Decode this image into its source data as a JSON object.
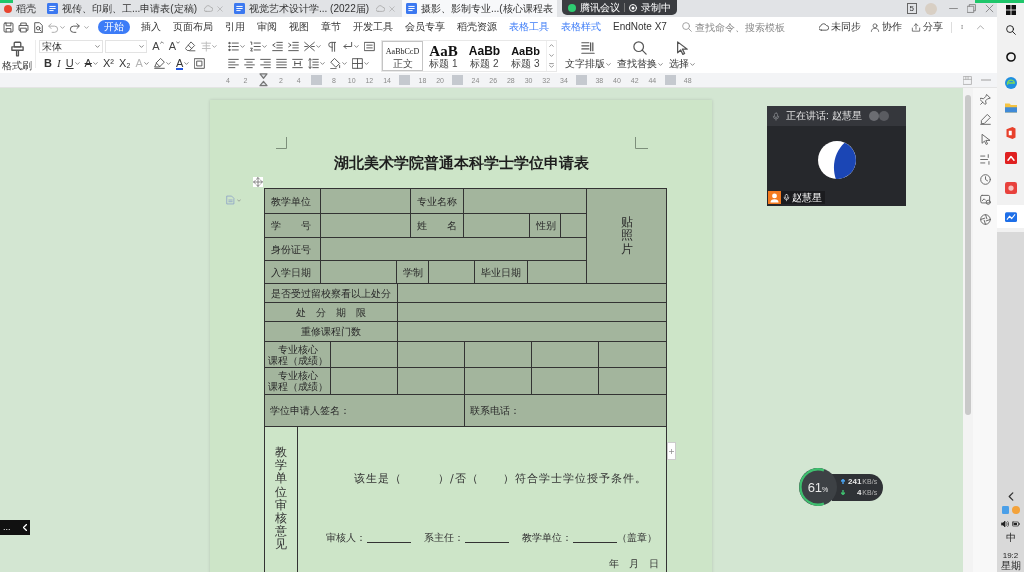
{
  "window_tabs": {
    "tabs": [
      {
        "kind": "home",
        "label": "稻壳",
        "selected": false
      },
      {
        "kind": "document",
        "label": "视传、印刷、工...申请表(定稿)",
        "selected": false
      },
      {
        "kind": "document",
        "label": "视觉艺术设计学... (2022届)",
        "selected": false
      },
      {
        "kind": "document",
        "label": "摄影、影制专业...(核心课程表",
        "selected": true
      }
    ],
    "window_count": "5"
  },
  "meeting_bar": {
    "app": "腾讯会议",
    "recording": "录制中"
  },
  "ribbon": {
    "tabs": [
      {
        "label": "开始",
        "selected": true,
        "contextual": false
      },
      {
        "label": "插入",
        "selected": false,
        "contextual": false
      },
      {
        "label": "页面布局",
        "selected": false,
        "contextual": false
      },
      {
        "label": "引用",
        "selected": false,
        "contextual": false
      },
      {
        "label": "审阅",
        "selected": false,
        "contextual": false
      },
      {
        "label": "视图",
        "selected": false,
        "contextual": false
      },
      {
        "label": "章节",
        "selected": false,
        "contextual": false
      },
      {
        "label": "开发工具",
        "selected": false,
        "contextual": false
      },
      {
        "label": "会员专享",
        "selected": false,
        "contextual": false
      },
      {
        "label": "稻壳资源",
        "selected": false,
        "contextual": false
      },
      {
        "label": "表格工具",
        "selected": false,
        "contextual": true
      },
      {
        "label": "表格样式",
        "selected": false,
        "contextual": true
      },
      {
        "label": "EndNote X7",
        "selected": false,
        "contextual": false
      }
    ],
    "search": {
      "placeholder": "查找命令、搜索模板"
    },
    "actions": [
      {
        "kind": "sync",
        "label": "未同步"
      },
      {
        "kind": "collaborate",
        "label": "协作"
      },
      {
        "kind": "share",
        "label": "分享"
      }
    ]
  },
  "toolbar": {
    "format_painter": "格式刷",
    "font": {
      "value": "宋体"
    },
    "font_tools": [
      {
        "kind": "grow",
        "glyph": "A"
      },
      {
        "kind": "shrink",
        "glyph": "A"
      },
      {
        "kind": "clear"
      },
      {
        "kind": "phonetic"
      }
    ],
    "format_tools": [
      {
        "kind": "bold",
        "glyph": "B"
      },
      {
        "kind": "italic",
        "glyph": "I"
      },
      {
        "kind": "underline",
        "glyph": "U"
      },
      {
        "kind": "strike",
        "glyph": "A"
      },
      {
        "kind": "superscript",
        "glyph": "X²"
      },
      {
        "kind": "subscript",
        "glyph": "X₂"
      },
      {
        "kind": "effect",
        "glyph": "A"
      },
      {
        "kind": "highlight"
      },
      {
        "kind": "color",
        "glyph": "A"
      },
      {
        "kind": "border"
      }
    ],
    "styles": [
      {
        "kind": "body",
        "preview": "AaBbCcD",
        "label": "正文",
        "selected": true
      },
      {
        "kind": "heading1",
        "preview": "AaB",
        "label": "标题 1",
        "selected": false
      },
      {
        "kind": "heading2",
        "preview": "AaBb",
        "label": "标题 2",
        "selected": false
      },
      {
        "kind": "heading3",
        "preview": "AaBb",
        "label": "标题 3",
        "selected": false
      }
    ],
    "tools": [
      {
        "kind": "layout",
        "label": "文字排版"
      },
      {
        "kind": "find",
        "label": "查找替换"
      },
      {
        "kind": "select",
        "label": "选择"
      }
    ]
  },
  "ruler": {
    "ticks": [
      {
        "kind": "number",
        "label": "4"
      },
      {
        "kind": "number",
        "label": "2"
      },
      {
        "kind": "indent"
      },
      {
        "kind": "number",
        "label": "2"
      },
      {
        "kind": "number",
        "label": "4"
      },
      {
        "kind": "marker"
      },
      {
        "kind": "number",
        "label": "8"
      },
      {
        "kind": "number",
        "label": "10"
      },
      {
        "kind": "number",
        "label": "12"
      },
      {
        "kind": "number",
        "label": "14"
      },
      {
        "kind": "marker"
      },
      {
        "kind": "number",
        "label": "18"
      },
      {
        "kind": "number",
        "label": "20"
      },
      {
        "kind": "marker"
      },
      {
        "kind": "number",
        "label": "24"
      },
      {
        "kind": "number",
        "label": "26"
      },
      {
        "kind": "number",
        "label": "28"
      },
      {
        "kind": "number",
        "label": "30"
      },
      {
        "kind": "number",
        "label": "32"
      },
      {
        "kind": "number",
        "label": "34"
      },
      {
        "kind": "marker"
      },
      {
        "kind": "number",
        "label": "38"
      },
      {
        "kind": "number",
        "label": "40"
      },
      {
        "kind": "number",
        "label": "42"
      },
      {
        "kind": "number",
        "label": "44"
      },
      {
        "kind": "marker"
      },
      {
        "kind": "number",
        "label": "48"
      }
    ]
  },
  "document": {
    "title": "湖北美术学院普通本科学士学位申请表",
    "table": {
      "upper_rows": [
        {
          "cells": [
            {
              "kind": "label",
              "text": "教学单位"
            },
            {
              "kind": "blank"
            },
            {
              "kind": "label",
              "text": "专业名称"
            },
            {
              "kind": "blank"
            }
          ]
        },
        {
          "cells": [
            {
              "kind": "label",
              "text": "学　　号"
            },
            {
              "kind": "blank"
            },
            {
              "kind": "label",
              "text": "姓　　名"
            },
            {
              "kind": "blank"
            },
            {
              "kind": "label",
              "text": "性别"
            },
            {
              "kind": "blank"
            }
          ]
        },
        {
          "cells": [
            {
              "kind": "label",
              "text": "身份证号"
            },
            {
              "kind": "blank"
            }
          ]
        },
        {
          "cells": [
            {
              "kind": "label",
              "text": "入学日期"
            },
            {
              "kind": "blank"
            },
            {
              "kind": "label",
              "text": "学制"
            },
            {
              "kind": "blank"
            },
            {
              "kind": "label",
              "text": "毕业日期"
            },
            {
              "kind": "blank"
            }
          ]
        }
      ],
      "photo_label": "贴照片",
      "rows": [
        {
          "cells": [
            {
              "kind": "label",
              "text": "是否受过留校察看以上处分"
            },
            {
              "kind": "blank"
            }
          ]
        },
        {
          "cells": [
            {
              "kind": "label",
              "text": "处　分　期　限"
            },
            {
              "kind": "blank"
            }
          ]
        },
        {
          "cells": [
            {
              "kind": "label",
              "text": "重修课程门数"
            },
            {
              "kind": "blank"
            }
          ]
        },
        {
          "cells": [
            {
              "kind": "label",
              "lines": [
                "专业核心",
                "课程（成绩）"
              ]
            },
            {
              "kind": "blank"
            },
            {
              "kind": "blank"
            },
            {
              "kind": "blank"
            },
            {
              "kind": "blank"
            },
            {
              "kind": "blank"
            }
          ]
        },
        {
          "cells": [
            {
              "kind": "label",
              "lines": [
                "专业核心",
                "课程（成绩）"
              ]
            },
            {
              "kind": "blank"
            },
            {
              "kind": "blank"
            },
            {
              "kind": "blank"
            },
            {
              "kind": "blank"
            },
            {
              "kind": "blank"
            }
          ]
        },
        {
          "cells": [
            {
              "kind": "label",
              "text": "学位申请人签名："
            },
            {
              "kind": "label",
              "text": "联系电话："
            }
          ]
        }
      ],
      "review": {
        "heading": "教学单位审核意见",
        "statement": "该生是（　　　）/否（　　）符合学士学位授予条件。",
        "signers": [
          "审核人：",
          "系主任：",
          "教学单位："
        ],
        "seal": "（盖章）",
        "date": "年　月　日"
      }
    }
  },
  "video_panel": {
    "speaking": "正在讲话: 赵慧星",
    "participant": "赵慧星"
  },
  "network_monitor": {
    "level": 0.61,
    "percent": "61",
    "unit": "%",
    "upload": {
      "value": "241",
      "unit": "KB/s"
    },
    "download": {
      "value": "4",
      "unit": "KB/s"
    }
  },
  "side_panel_tab": {
    "label": "..."
  },
  "taskbar": {
    "input_method": "中",
    "time": "19:2",
    "day": "星期"
  }
}
